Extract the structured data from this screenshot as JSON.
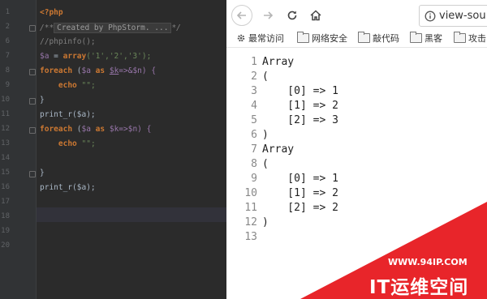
{
  "ide": {
    "line_numbers": [
      "1",
      "2",
      "6",
      "7",
      "8",
      "9",
      "10",
      "11",
      "12",
      "13",
      "14",
      "15",
      "16",
      "17",
      "18",
      "19",
      "20"
    ],
    "code": {
      "php_open": "<?php",
      "comment_start": "/**",
      "fold_hint": "Created by PhpStorm. ...",
      "comment_end": "*/",
      "l3": "//phpinfo();",
      "l4_var": "$a",
      "l4_eq": " = ",
      "l4_fn": "array",
      "l4_args": "('1','2','3');",
      "l5_kw": "foreach",
      "l5_open": " (",
      "l5_var": "$a",
      "l5_as": " as ",
      "l5_k": "$k",
      "l5_rest": "=>&$n) {",
      "l6_kw": "echo",
      "l6_str": " \"\";",
      "l7": "}",
      "l8": "print_r($a);",
      "l9_kw": "foreach",
      "l9_open": " (",
      "l9_var": "$a",
      "l9_as": " as ",
      "l9_k": "$k",
      "l9_rest": "=>$n) {",
      "l10_kw": "echo",
      "l10_str": " \"\";",
      "l11": "}",
      "l12": "print_r($a);"
    }
  },
  "browser": {
    "url": "view-sou",
    "icons": {
      "back": "back-arrow-icon",
      "forward": "forward-arrow-icon",
      "reload": "reload-icon",
      "home": "home-icon",
      "info": "info-icon"
    },
    "bookmarks": [
      {
        "label": "最常访问",
        "icon": "gear-icon"
      },
      {
        "label": "网络安全",
        "icon": "folder-icon"
      },
      {
        "label": "敲代码",
        "icon": "folder-icon"
      },
      {
        "label": "黑客",
        "icon": "folder-icon"
      },
      {
        "label": "攻击",
        "icon": "folder-icon"
      }
    ],
    "source_lines": [
      {
        "n": "1",
        "t": "Array"
      },
      {
        "n": "2",
        "t": "("
      },
      {
        "n": "3",
        "t": "    [0] => 1"
      },
      {
        "n": "4",
        "t": "    [1] => 2"
      },
      {
        "n": "5",
        "t": "    [2] => 3"
      },
      {
        "n": "6",
        "t": ")"
      },
      {
        "n": "7",
        "t": "Array"
      },
      {
        "n": "8",
        "t": "("
      },
      {
        "n": "9",
        "t": "    [0] => 1"
      },
      {
        "n": "10",
        "t": "    [1] => 2"
      },
      {
        "n": "11",
        "t": "    [2] => 2"
      },
      {
        "n": "12",
        "t": ")"
      },
      {
        "n": "13",
        "t": ""
      }
    ]
  },
  "watermark": {
    "url": "WWW.94IP.COM",
    "name": "IT运维空间",
    "color": "#e8252a"
  }
}
